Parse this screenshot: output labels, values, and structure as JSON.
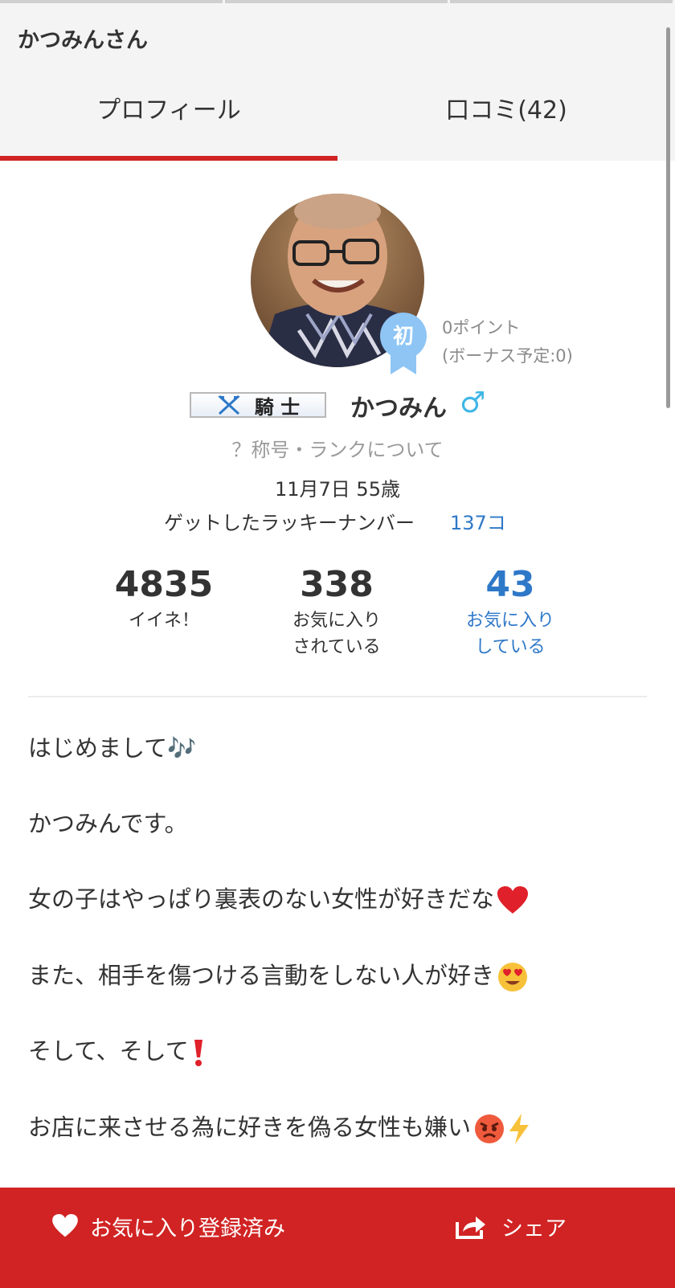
{
  "header": {
    "title": "かつみんさん"
  },
  "tabs": [
    {
      "label": "プロフィール",
      "active": true
    },
    {
      "label": "口コミ(42)",
      "active": false
    }
  ],
  "profile": {
    "points": "0ポイント",
    "bonus": "(ボーナス予定:0)",
    "badge_char": "初",
    "rank_title": "騎 士",
    "nickname": "かつみん",
    "gender_symbol": "♂",
    "rank_link": "？称号・ランクについて",
    "birthday": "11月7日 55歳",
    "lucky_label": "ゲットしたラッキーナンバー",
    "lucky_count": "137コ"
  },
  "stats": [
    {
      "value": "4835",
      "label": "イイネ！"
    },
    {
      "value": "338",
      "label": "お気に入り\nされている"
    },
    {
      "value": "43",
      "label": "お気に入り\nしている"
    }
  ],
  "intro": [
    "はじめまして🎶",
    "かつみんです。",
    "女の子はやっぱり裏表のない女性が好きだな",
    "また、相手を傷つける言動をしない人が好き",
    "そして、そして",
    "お店に来させる為に好きを偽る女性も嫌い"
  ],
  "footer": {
    "favorite_label": "お気に入り登録済み",
    "share_label": "シェア"
  },
  "colors": {
    "accent_red": "#d12323",
    "link_blue": "#2e78c8",
    "badge_blue": "#8ec5f5",
    "gender_blue": "#3fb6e6"
  }
}
